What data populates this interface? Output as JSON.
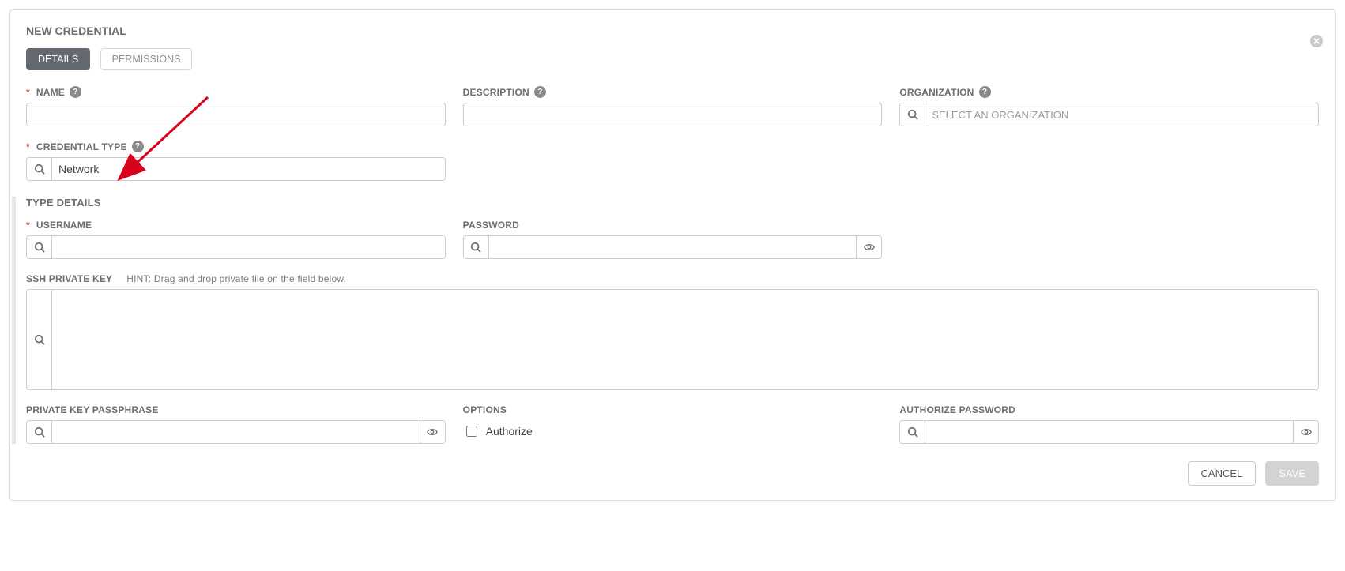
{
  "header": {
    "title": "NEW CREDENTIAL"
  },
  "tabs": {
    "details": "DETAILS",
    "permissions": "PERMISSIONS"
  },
  "fields": {
    "name": {
      "label": "NAME",
      "value": ""
    },
    "description": {
      "label": "DESCRIPTION",
      "value": ""
    },
    "organization": {
      "label": "ORGANIZATION",
      "placeholder": "SELECT AN ORGANIZATION",
      "value": ""
    },
    "credential_type": {
      "label": "CREDENTIAL TYPE",
      "value": "Network"
    }
  },
  "type_details": {
    "section_title": "TYPE DETAILS",
    "username": {
      "label": "USERNAME",
      "value": ""
    },
    "password": {
      "label": "PASSWORD",
      "value": ""
    },
    "ssh_key": {
      "label": "SSH PRIVATE KEY",
      "hint": "HINT: Drag and drop private file on the field below.",
      "value": ""
    },
    "passphrase": {
      "label": "PRIVATE KEY PASSPHRASE",
      "value": ""
    },
    "options": {
      "label": "OPTIONS",
      "authorize_label": "Authorize",
      "authorize_checked": false
    },
    "auth_password": {
      "label": "AUTHORIZE PASSWORD",
      "value": ""
    }
  },
  "footer": {
    "cancel": "CANCEL",
    "save": "SAVE"
  }
}
